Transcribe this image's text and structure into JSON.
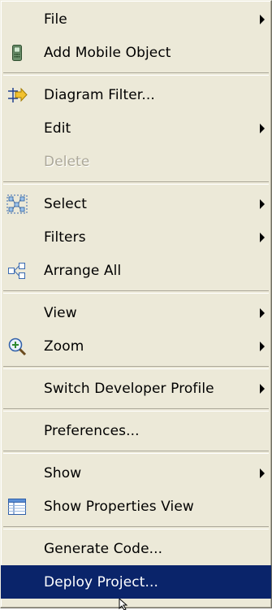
{
  "menu": {
    "groups": [
      [
        {
          "label": "File",
          "submenu": true,
          "icon": ""
        },
        {
          "label": "Add Mobile Object",
          "submenu": false,
          "icon": "mobile-device-icon"
        }
      ],
      [
        {
          "label": "Diagram Filter...",
          "submenu": false,
          "icon": "filter-arrow-icon"
        },
        {
          "label": "Edit",
          "submenu": true,
          "icon": ""
        },
        {
          "label": "Delete",
          "submenu": false,
          "icon": "",
          "disabled": true
        }
      ],
      [
        {
          "label": "Select",
          "submenu": true,
          "icon": "select-nodes-icon"
        },
        {
          "label": "Filters",
          "submenu": true,
          "icon": ""
        },
        {
          "label": "Arrange All",
          "submenu": false,
          "icon": "arrange-all-icon"
        }
      ],
      [
        {
          "label": "View",
          "submenu": true,
          "icon": ""
        },
        {
          "label": "Zoom",
          "submenu": true,
          "icon": "zoom-in-icon"
        }
      ],
      [
        {
          "label": "Switch Developer Profile",
          "submenu": true,
          "icon": ""
        }
      ],
      [
        {
          "label": "Preferences...",
          "submenu": false,
          "icon": ""
        }
      ],
      [
        {
          "label": "Show",
          "submenu": true,
          "icon": ""
        },
        {
          "label": "Show Properties View",
          "submenu": false,
          "icon": "properties-table-icon"
        }
      ],
      [
        {
          "label": "Generate Code...",
          "submenu": false,
          "icon": ""
        },
        {
          "label": "Deploy Project...",
          "submenu": false,
          "icon": "",
          "highlighted": true
        }
      ]
    ]
  },
  "colors": {
    "menu_bg": "#ece9d8",
    "highlight_bg": "#0a246a",
    "disabled_text": "#aca899"
  }
}
